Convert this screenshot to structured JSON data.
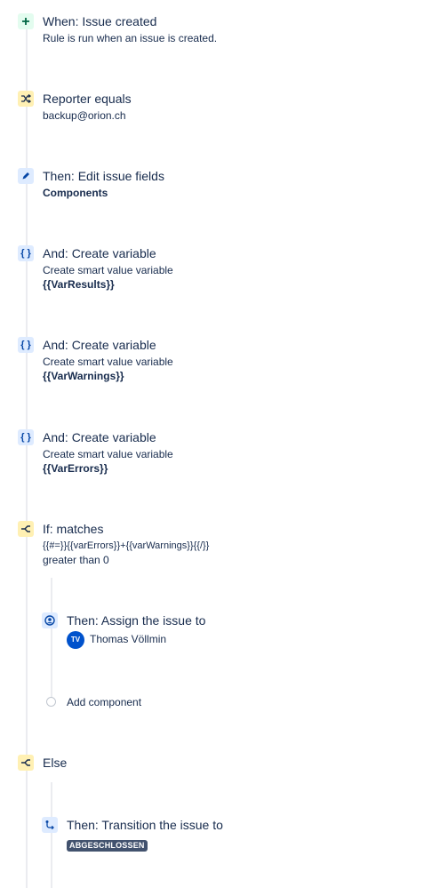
{
  "steps": [
    {
      "title": "When: Issue created",
      "desc": "Rule is run when an issue is created.",
      "icon": "plus-icon"
    },
    {
      "title": "Reporter equals",
      "desc": "backup@orion.ch",
      "icon": "shuffle-icon"
    },
    {
      "title": "Then: Edit issue fields",
      "desc": "Components",
      "icon": "pencil-icon"
    },
    {
      "title": "And: Create variable",
      "desc": "Create smart value variable",
      "value": "{{VarResults}}",
      "icon": "braces-icon"
    },
    {
      "title": "And: Create variable",
      "desc": "Create smart value variable",
      "value": "{{VarWarnings}}",
      "icon": "braces-icon"
    },
    {
      "title": "And: Create variable",
      "desc": "Create smart value variable",
      "value": "{{VarErrors}}",
      "icon": "braces-icon"
    },
    {
      "title": "If: matches",
      "desc": "{{#=}}{{varErrors}}+{{varWarnings}}{{/}}",
      "desc2": "greater than 0",
      "icon": "branch-icon"
    }
  ],
  "if_branch": {
    "assign": {
      "title": "Then: Assign the issue to",
      "avatar_initials": "TV",
      "user": "Thomas Völlmin",
      "icon": "user-circle-icon"
    },
    "add_component": "Add component"
  },
  "else_step": {
    "title": "Else",
    "icon": "branch-icon"
  },
  "else_branch": {
    "transition": {
      "title": "Then: Transition the issue to",
      "status": "ABGESCHLOSSEN",
      "icon": "transition-icon"
    }
  },
  "colors": {
    "trigger": "#e3fcef",
    "condition": "#fff0b3",
    "action": "#deebff",
    "avatar": "#0052cc",
    "lozenge": "#42526e"
  }
}
